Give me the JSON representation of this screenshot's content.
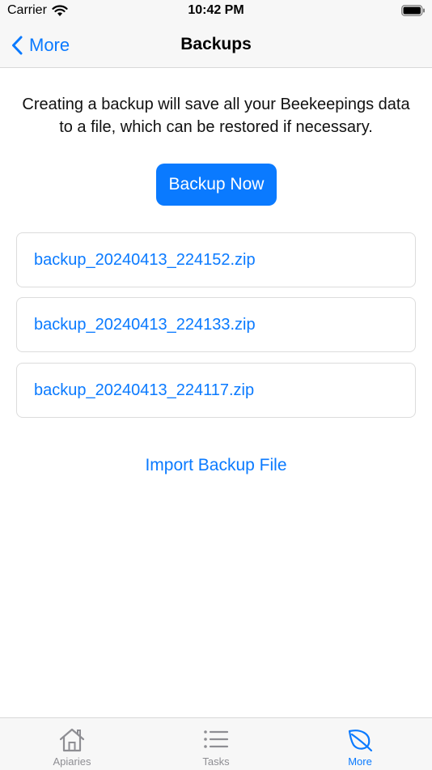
{
  "status_bar": {
    "carrier": "Carrier",
    "time": "10:42 PM"
  },
  "nav": {
    "back_label": "More",
    "title": "Backups"
  },
  "description": "Creating a backup will save all your Beekeepings data to a file, which can be restored if necessary.",
  "backup_button": "Backup Now",
  "backups": [
    "backup_20240413_224152.zip",
    "backup_20240413_224133.zip",
    "backup_20240413_224117.zip"
  ],
  "import_label": "Import Backup File",
  "tabs": [
    {
      "label": "Apiaries",
      "icon": "house-icon",
      "active": false
    },
    {
      "label": "Tasks",
      "icon": "list-icon",
      "active": false
    },
    {
      "label": "More",
      "icon": "leaf-icon",
      "active": true
    }
  ],
  "colors": {
    "accent": "#0a7aff",
    "inactive": "#8e8e93"
  }
}
